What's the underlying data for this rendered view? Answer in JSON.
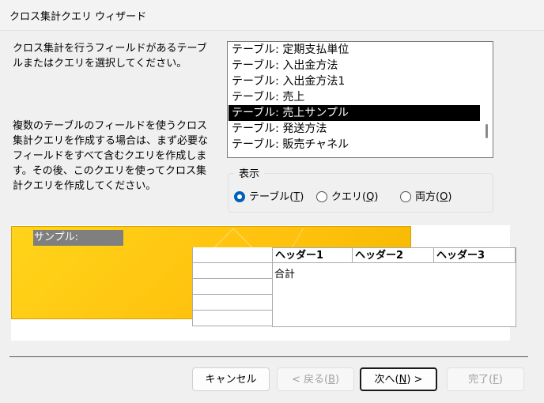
{
  "window": {
    "title": "クロス集計クエリ ウィザード"
  },
  "instructions": {
    "select_source": "クロス集計を行うフィールドがあるテーブルまたはクエリを選択してください。",
    "multiple_tables": "複数のテーブルのフィールドを使うクロス集計クエリを作成する場合は、まず必要なフィールドをすべて含むクエリを作成します。その後、このクエリを使ってクロス集計クエリを作成してください。"
  },
  "source_list": {
    "items": [
      "テーブル: 定期支払単位",
      "テーブル: 入出金方法",
      "テーブル: 入出金方法1",
      "テーブル: 売上",
      "テーブル: 売上サンプル",
      "テーブル: 発送方法",
      "テーブル: 販売チャネル"
    ],
    "selected_index": 4
  },
  "view_options": {
    "legend": "表示",
    "tables": {
      "text": "テーブル(",
      "key": "T",
      "close": ")"
    },
    "queries": {
      "text": "クエリ(",
      "key": "Q",
      "close": ")"
    },
    "both": {
      "text": "両方(",
      "key": "O",
      "close": ")"
    },
    "selected": "tables"
  },
  "preview": {
    "sample_label": "サンプル:",
    "col_headers": [
      "ヘッダー1",
      "ヘッダー2",
      "ヘッダー3"
    ],
    "total_label": "合計"
  },
  "buttons": {
    "cancel": "キャンセル",
    "back": {
      "text": "< 戻る(",
      "key": "B",
      "close": ")"
    },
    "next": {
      "text": "次へ(",
      "key": "N",
      "close": ") >"
    },
    "finish": {
      "text": "完了(",
      "key": "F",
      "close": ")"
    }
  }
}
